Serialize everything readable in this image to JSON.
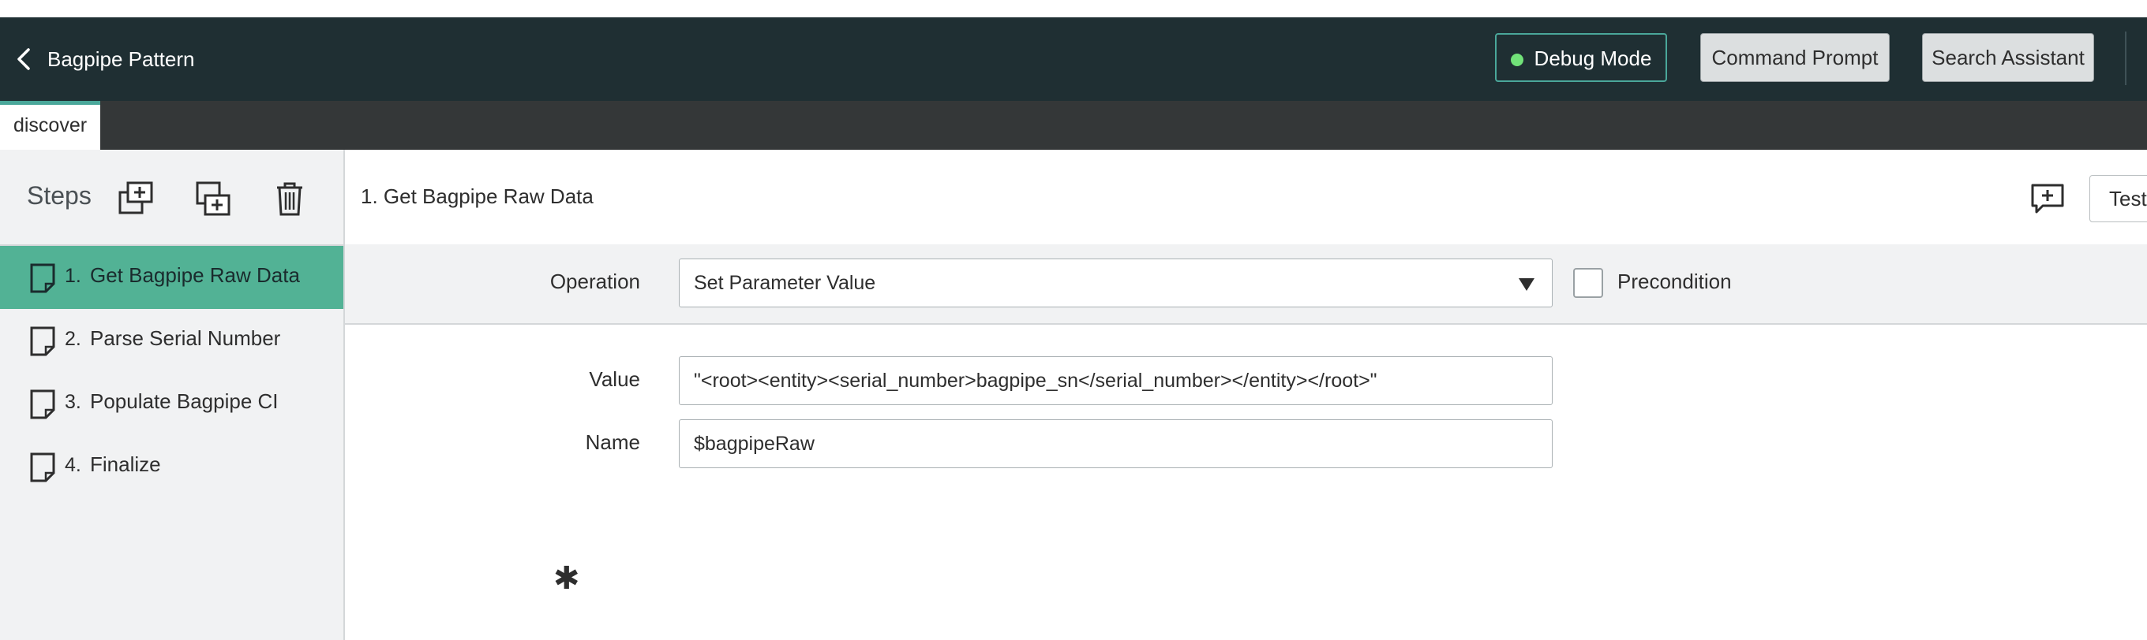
{
  "header": {
    "title": "Bagpipe Pattern",
    "debug_label": "Debug Mode",
    "command_prompt_label": "Command Prompt",
    "search_assistant_label": "Search Assistant"
  },
  "tabs": [
    {
      "label": "discover",
      "active": true
    }
  ],
  "sidebar": {
    "steps_label": "Steps",
    "steps": [
      {
        "num": "1.",
        "label": "Get Bagpipe Raw Data",
        "active": true
      },
      {
        "num": "2.",
        "label": "Parse Serial Number",
        "active": false
      },
      {
        "num": "3.",
        "label": "Populate Bagpipe CI",
        "active": false
      },
      {
        "num": "4.",
        "label": "Finalize",
        "active": false
      }
    ]
  },
  "main": {
    "step_title": "1. Get Bagpipe Raw Data",
    "test_label": "Test",
    "operation_label": "Operation",
    "operation_value": "Set Parameter Value",
    "precondition_label": "Precondition",
    "value_label": "Value",
    "value_value": "\"<root><entity><serial_number>bagpipe_sn</serial_number></entity></root>\"",
    "name_label": "Name",
    "name_value": "$bagpipeRaw"
  },
  "colors": {
    "header_bg": "#1f2f33",
    "accent": "#4aa79a",
    "active_step": "#52b295",
    "debug_dot": "#71e279",
    "tabbar_bg": "#343738"
  }
}
